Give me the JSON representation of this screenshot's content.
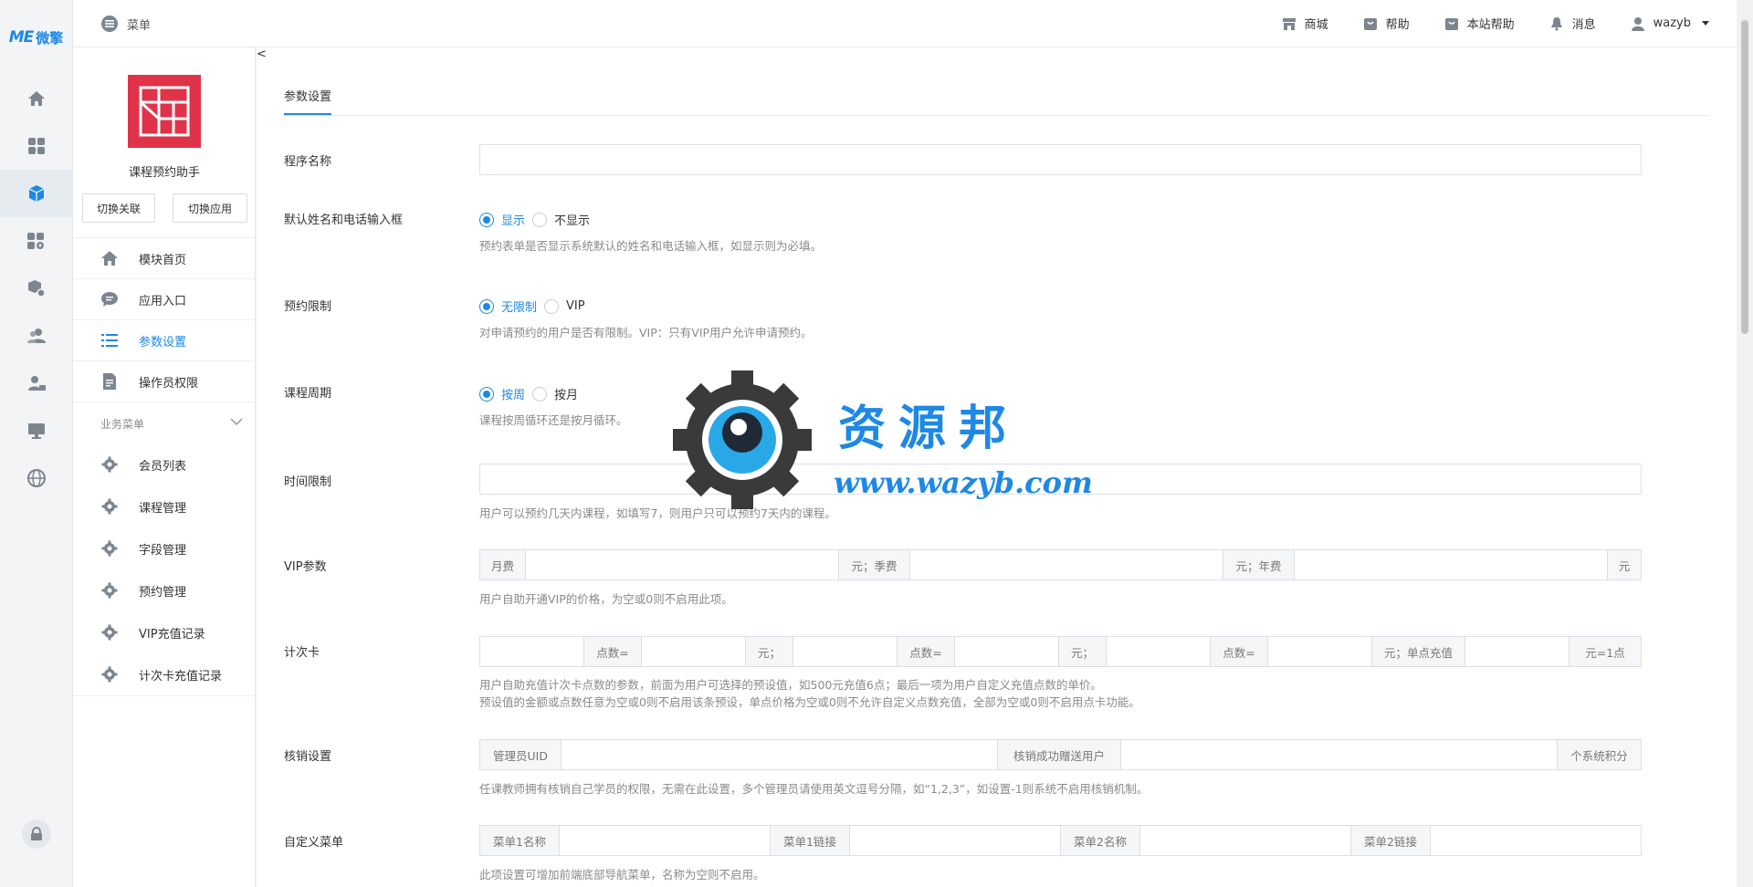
{
  "brand": {
    "logo_me": "ME",
    "logo_cn": "微擎"
  },
  "topbar": {
    "menu_label": "菜单",
    "items": [
      {
        "label": "商城",
        "icon": "store-icon"
      },
      {
        "label": "帮助",
        "icon": "help-bag-icon"
      },
      {
        "label": "本站帮助",
        "icon": "site-help-icon"
      },
      {
        "label": "消息",
        "icon": "bell-icon"
      }
    ],
    "user": "wazyb"
  },
  "sidebar": {
    "app_name": "课程预约助手",
    "switch_link": "切换关联",
    "switch_app": "切换应用",
    "nav": [
      {
        "label": "模块首页",
        "icon": "home-icon"
      },
      {
        "label": "应用入口",
        "icon": "chat-icon"
      },
      {
        "label": "参数设置",
        "icon": "list-icon"
      },
      {
        "label": "操作员权限",
        "icon": "document-icon"
      }
    ],
    "section_title": "业务菜单",
    "biz": [
      {
        "label": "会员列表"
      },
      {
        "label": "课程管理"
      },
      {
        "label": "字段管理"
      },
      {
        "label": "预约管理"
      },
      {
        "label": "VIP充值记录"
      },
      {
        "label": "计次卡充值记录"
      }
    ]
  },
  "main": {
    "tab": "参数设置",
    "fields": {
      "program_name": {
        "label": "程序名称",
        "value": ""
      },
      "name_phone": {
        "label": "默认姓名和电话输入框",
        "options": [
          "显示",
          "不显示"
        ],
        "help": "预约表单是否显示系统默认的姓名和电话输入框，如显示则为必填。"
      },
      "limit": {
        "label": "预约限制",
        "options": [
          "无限制",
          "VIP"
        ],
        "help": "对申请预约的用户是否有限制。VIP：只有VIP用户允许申请预约。"
      },
      "cycle": {
        "label": "课程周期",
        "options": [
          "按周",
          "按月"
        ],
        "help": "课程按周循环还是按月循环。"
      },
      "time_limit": {
        "label": "时间限制",
        "value": "",
        "help": "用户可以预约几天内课程，如填写7，则用户只可以预约7天内的课程。"
      },
      "vip": {
        "label": "VIP参数",
        "addons": [
          "月费",
          "元；季费",
          "元；年费",
          "元"
        ],
        "help": "用户自助开通VIP的价格，为空或0则不启用此项。"
      },
      "card": {
        "label": "计次卡",
        "addons": [
          "点数=",
          "元；",
          "点数=",
          "元；",
          "点数=",
          "元；单点充值",
          "元=1点"
        ],
        "help1": "用户自助充值计次卡点数的参数，前面为用户可选择的预设值，如500元充值6点；最后一项为用户自定义充值点数的单价。",
        "help2": "预设值的金额或点数任意为空或0则不启用该条预设，单点价格为空或0则不允许自定义点数充值，全部为空或0则不启用点卡功能。"
      },
      "verify": {
        "label": "核销设置",
        "addons": [
          "管理员UID",
          "核销成功赠送用户",
          "个系统积分"
        ],
        "help": "任课教师拥有核销自己学员的权限，无需在此设置，多个管理员请使用英文逗号分隔，如“1,2,3”，如设置-1则系统不启用核销机制。"
      },
      "menu": {
        "label": "自定义菜单",
        "addons": [
          "菜单1名称",
          "菜单1链接",
          "菜单2名称",
          "菜单2链接"
        ],
        "help": "此项设置可增加前端底部导航菜单，名称为空则不启用。"
      }
    }
  },
  "watermark": {
    "title": "资源邦",
    "url": "www.wazyb.com"
  },
  "colors": {
    "accent": "#1e88e5",
    "app_logo": "#e0334a",
    "icon_gray": "#7d858f"
  }
}
